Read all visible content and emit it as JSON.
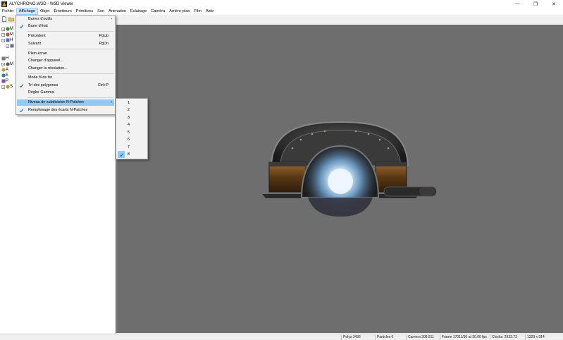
{
  "window": {
    "title": "ALYCHRONO.W3D - W3D Viewer",
    "minimize_glyph": "—",
    "maximize_glyph": "❐",
    "close_glyph": "✕"
  },
  "menubar": {
    "items": [
      "Fichier",
      "Affichage",
      "Objet",
      "Émetteurs",
      "Primitives",
      "Son",
      "Animation",
      "Éclairage",
      "Caméra",
      "Arrière-plan",
      "Film",
      "Aide"
    ],
    "active_index": 1
  },
  "tree": {
    "letters": [
      "M",
      "M",
      "H",
      "H",
      "M",
      "A",
      "E",
      "P",
      "S"
    ],
    "expanders": [
      "+",
      "+",
      "−",
      "−",
      "+"
    ]
  },
  "affichage_menu": {
    "items": [
      {
        "label": "Barres d'outils",
        "checked": false,
        "has_submenu": true
      },
      {
        "label": "Barre d'état",
        "checked": true
      },
      {
        "label": "Précédent",
        "shortcut": "PgUp"
      },
      {
        "label": "Suivant",
        "shortcut": "PgDn"
      },
      {
        "label": "Plein écran"
      },
      {
        "label": "Changer d'appareil..."
      },
      {
        "label": "Changer la résolution..."
      },
      {
        "label": "Mode fil de fer"
      },
      {
        "label": "Tri des polygones",
        "checked": true,
        "shortcut": "Ctrl+P"
      },
      {
        "label": "Régler Gamma"
      },
      {
        "label": "Niveau de subdivision N-Patches",
        "has_submenu": true,
        "highlighted": true
      },
      {
        "label": "Remplissage des écarts N-Patches",
        "checked": true
      }
    ],
    "submenu_arrow": "›"
  },
  "subdivision_submenu": {
    "items": [
      "1",
      "2",
      "3",
      "4",
      "5",
      "6",
      "7",
      "8"
    ],
    "checked_index": 7
  },
  "statusbar": {
    "polys": "Polys 3436",
    "particles": "Particles 0",
    "camera": "Camera 308.511",
    "frame": "Frame 17011/30 at 30.00 fps",
    "clocks": "Clocks: 2933.73",
    "resolution": "1329 x 914"
  },
  "colors": {
    "viewport_bg": "#6e6e6e",
    "menu_highlight": "#91c9f7",
    "check_blue": "#1e73d2"
  },
  "icons": {
    "app": "app-logo-icon",
    "check": "checkmark-icon",
    "new_file": "new-file-icon",
    "open_folder": "open-folder-icon"
  }
}
